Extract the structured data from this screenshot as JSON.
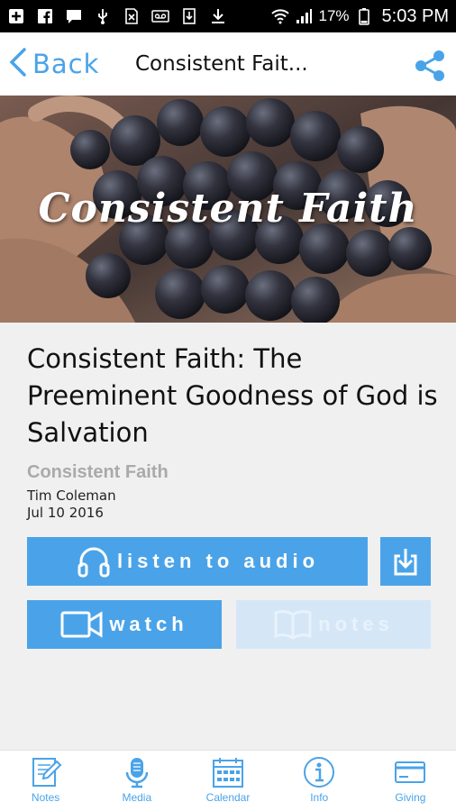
{
  "status_bar": {
    "battery": "17%",
    "time": "5:03 PM"
  },
  "nav": {
    "back_label": "Back",
    "title": "Consistent Fait..."
  },
  "hero": {
    "title": "Consistent Faith"
  },
  "sermon": {
    "title": "Consistent Faith: The Preeminent Goodness of God is Salvation",
    "series": "Consistent Faith",
    "speaker": "Tim Coleman",
    "date": "Jul 10 2016"
  },
  "actions": {
    "listen_label": "listen to audio",
    "watch_label": "watch",
    "notes_label": "notes"
  },
  "tabs": [
    {
      "label": "Notes",
      "icon": "notes-icon"
    },
    {
      "label": "Media",
      "icon": "microphone-icon"
    },
    {
      "label": "Calendar",
      "icon": "calendar-icon"
    },
    {
      "label": "Info",
      "icon": "info-icon"
    },
    {
      "label": "Giving",
      "icon": "credit-card-icon"
    }
  ],
  "colors": {
    "accent": "#4aa3e8",
    "disabled": "#d5e7f7",
    "background": "#f0f0f0"
  }
}
